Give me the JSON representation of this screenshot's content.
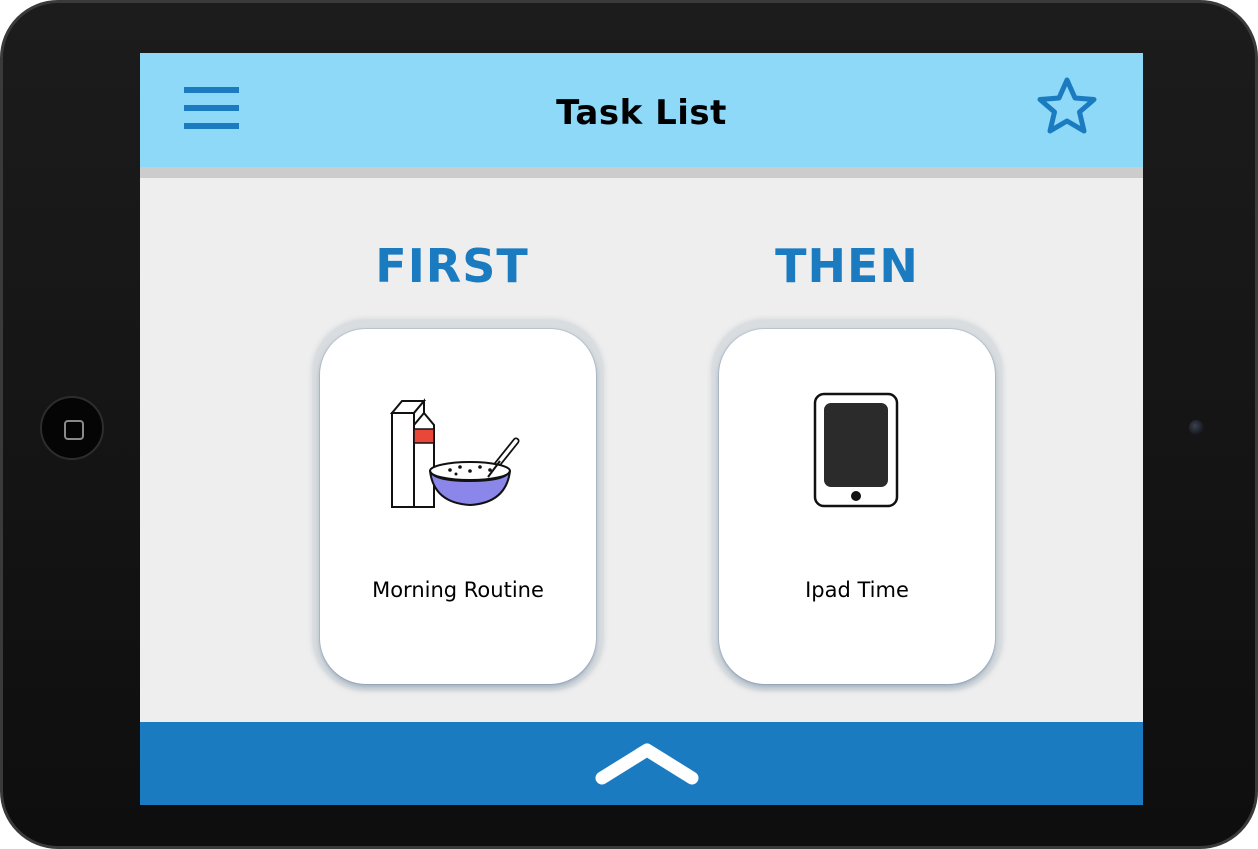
{
  "header": {
    "title": "Task List",
    "menu_icon": "hamburger-menu-icon",
    "favorite_icon": "star-icon"
  },
  "columns": [
    {
      "heading": "FIRST",
      "card": {
        "label": "Morning Routine",
        "icon": "breakfast-milk-cereal-icon"
      }
    },
    {
      "heading": "THEN",
      "card": {
        "label": "Ipad Time",
        "icon": "tablet-device-icon"
      }
    }
  ],
  "footer": {
    "expand_icon": "chevron-up-icon"
  },
  "colors": {
    "header_bg": "#8ed8f8",
    "accent_blue": "#1b7bc1",
    "screen_bg": "#eeeeee",
    "card_bg": "#ffffff"
  }
}
